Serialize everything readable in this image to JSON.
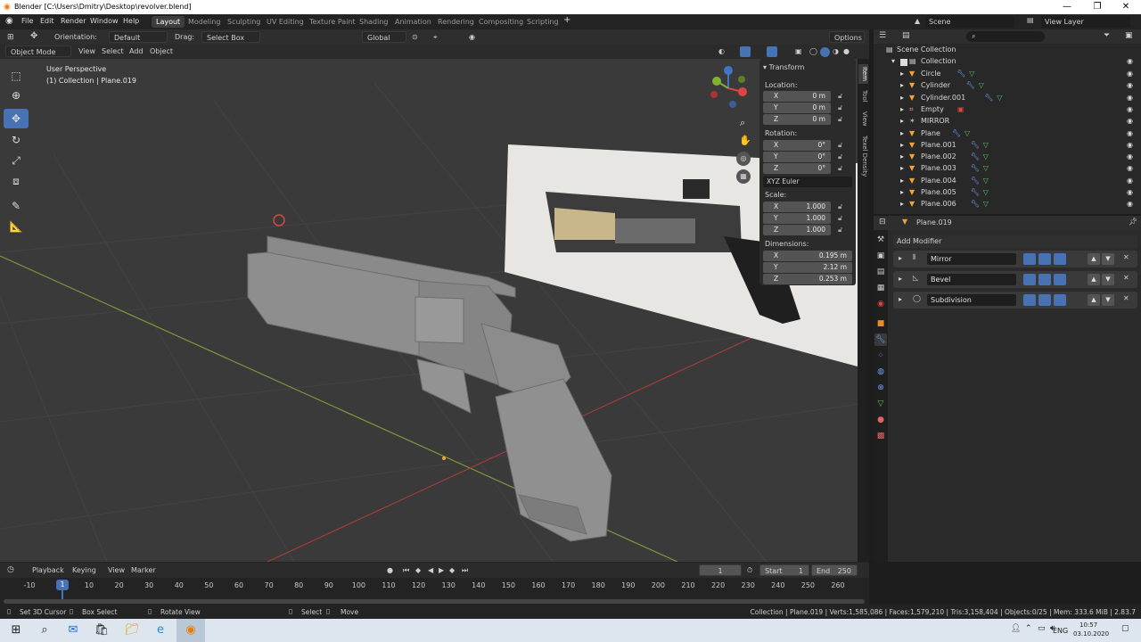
{
  "window": {
    "title": "Blender [C:\\Users\\Dmitry\\Desktop\\revolver.blend]",
    "minimize": "—",
    "maximize": "❐",
    "close": "✕"
  },
  "menu": [
    "File",
    "Edit",
    "Render",
    "Window",
    "Help"
  ],
  "workspaces": [
    "Layout",
    "Modeling",
    "Sculpting",
    "UV Editing",
    "Texture Paint",
    "Shading",
    "Animation",
    "Rendering",
    "Compositing",
    "Scripting"
  ],
  "scene": {
    "label": "Scene",
    "view_layer": "View Layer"
  },
  "viewport": {
    "orientation_label": "Orientation:",
    "orientation_value": "Default",
    "drag_label": "Drag:",
    "drag_value": "Select Box",
    "transform_orientation": "Global",
    "options": "Options",
    "mode": "Object Mode",
    "view": "View",
    "select": "Select",
    "add": "Add",
    "object": "Object",
    "overlay_line1": "User Perspective",
    "overlay_line2": "(1) Collection | Plane.019"
  },
  "npanel": {
    "title": "Transform",
    "location_label": "Location:",
    "rotation_label": "Rotation:",
    "scale_label": "Scale:",
    "dimensions_label": "Dimensions:",
    "location": [
      {
        "ax": "X",
        "v": "0 m"
      },
      {
        "ax": "Y",
        "v": "0 m"
      },
      {
        "ax": "Z",
        "v": "0 m"
      }
    ],
    "rotation": [
      {
        "ax": "X",
        "v": "0°"
      },
      {
        "ax": "Y",
        "v": "0°"
      },
      {
        "ax": "Z",
        "v": "0°"
      }
    ],
    "euler": "XYZ Euler",
    "scale": [
      {
        "ax": "X",
        "v": "1.000"
      },
      {
        "ax": "Y",
        "v": "1.000"
      },
      {
        "ax": "Z",
        "v": "1.000"
      }
    ],
    "dimensions": [
      {
        "ax": "X",
        "v": "0.195 m"
      },
      {
        "ax": "Y",
        "v": "2.12 m"
      },
      {
        "ax": "Z",
        "v": "0.253 m"
      }
    ],
    "tabs": [
      "Item",
      "Tool",
      "View",
      "Texel Density"
    ]
  },
  "outliner": {
    "root": "Scene Collection",
    "collection": "Collection",
    "items": [
      "Circle",
      "Cylinder",
      "Cylinder.001",
      "Empty",
      "MIRROR",
      "Plane",
      "Plane.001",
      "Plane.002",
      "Plane.003",
      "Plane.004",
      "Plane.005",
      "Plane.006"
    ]
  },
  "properties": {
    "object_name": "Plane.019",
    "add_modifier": "Add Modifier",
    "modifiers": [
      "Mirror",
      "Bevel",
      "Subdivision"
    ]
  },
  "timeline": {
    "playback": "Playback",
    "keying": "Keying",
    "view": "View",
    "marker": "Marker",
    "current_frame": "1",
    "start_label": "Start",
    "start": "1",
    "end_label": "End",
    "end": "250",
    "ticks": [
      "-10",
      "1",
      "10",
      "20",
      "30",
      "40",
      "50",
      "60",
      "70",
      "80",
      "90",
      "100",
      "110",
      "120",
      "130",
      "140",
      "150",
      "160",
      "170",
      "180",
      "190",
      "200",
      "210",
      "220",
      "230",
      "240",
      "250",
      "260"
    ]
  },
  "statusbar": {
    "set_cursor": "Set 3D Cursor",
    "box_select": "Box Select",
    "rotate_view": "Rotate View",
    "select": "Select",
    "move": "Move",
    "stats": "Collection | Plane.019 | Verts:1,585,086 | Faces:1,579,210 | Tris:3,158,404 | Objects:0/25 | Mem: 333.6 MiB | 2.83.7"
  },
  "taskbar": {
    "lang": "ENG",
    "time": "10:57",
    "date": "03.10.2020"
  },
  "colors": {
    "accent": "#4772b3",
    "viewport_bg": "#3a3a3a",
    "x_axis": "#c84545",
    "y_axis": "#8ab53a"
  }
}
